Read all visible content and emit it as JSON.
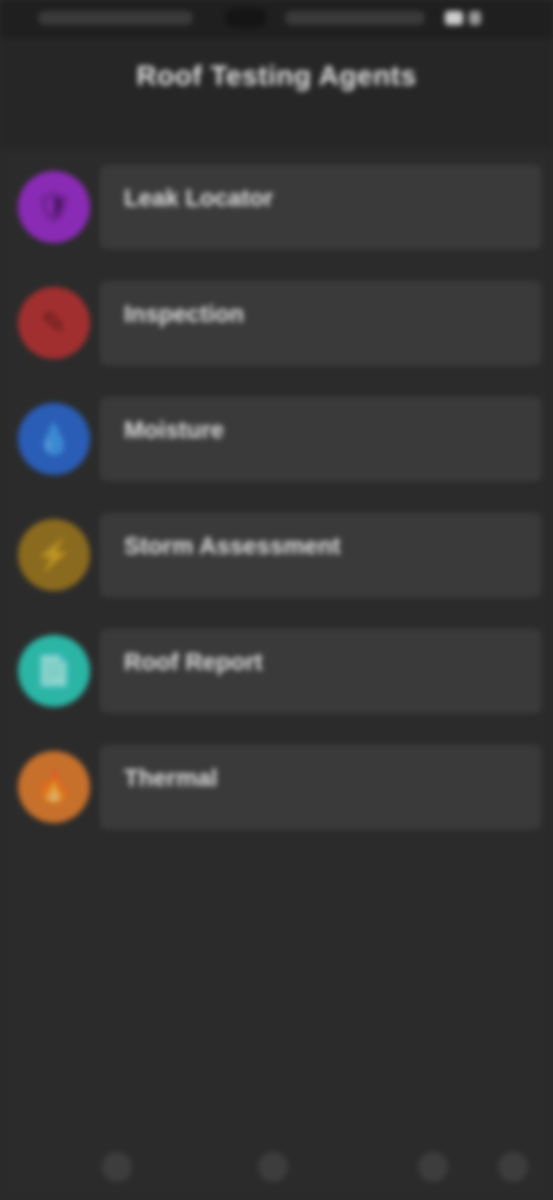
{
  "header": {
    "title": "Roof Testing Agents"
  },
  "menu": {
    "items": [
      {
        "label": "Leak Locator",
        "icon": "shield-icon",
        "color": "#8a2bb5",
        "glyph": "🛡"
      },
      {
        "label": "Inspection",
        "icon": "tool-icon",
        "color": "#a22f2f",
        "glyph": "✎"
      },
      {
        "label": "Moisture",
        "icon": "drop-icon",
        "color": "#2a5db6",
        "glyph": "💧"
      },
      {
        "label": "Storm Assessment",
        "icon": "lightning-icon",
        "color": "#8a6a1e",
        "glyph": "⚡"
      },
      {
        "label": "Roof Report",
        "icon": "document-icon",
        "color": "#2bb5a5",
        "glyph": "📄"
      },
      {
        "label": "Thermal",
        "icon": "flame-icon",
        "color": "#c6702c",
        "glyph": "🔥"
      }
    ]
  },
  "nav": {
    "buttons": [
      "back-nav-icon",
      "home-nav-icon",
      "recents-nav-icon",
      "menu-nav-icon"
    ]
  }
}
